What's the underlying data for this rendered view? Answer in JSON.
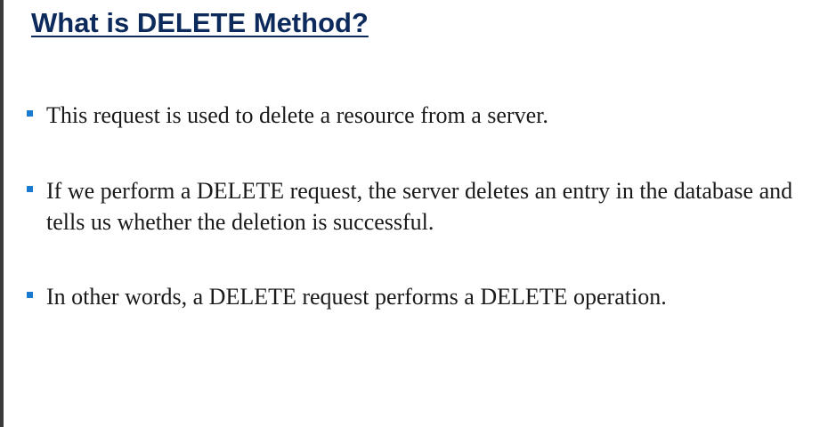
{
  "slide": {
    "title": "What is DELETE Method?",
    "bullets": [
      {
        "text": "This request is used to delete a resource from a server."
      },
      {
        "text": "If we perform a DELETE request, the server deletes an entry in the database and tells us whether the deletion is successful."
      },
      {
        "text": "In other words, a DELETE request performs a DELETE operation."
      }
    ]
  },
  "colors": {
    "title": "#0d2a5c",
    "bullet_marker": "#1a7bd0",
    "body_text": "#1a1a1a",
    "left_border": "#3a3a3a"
  }
}
